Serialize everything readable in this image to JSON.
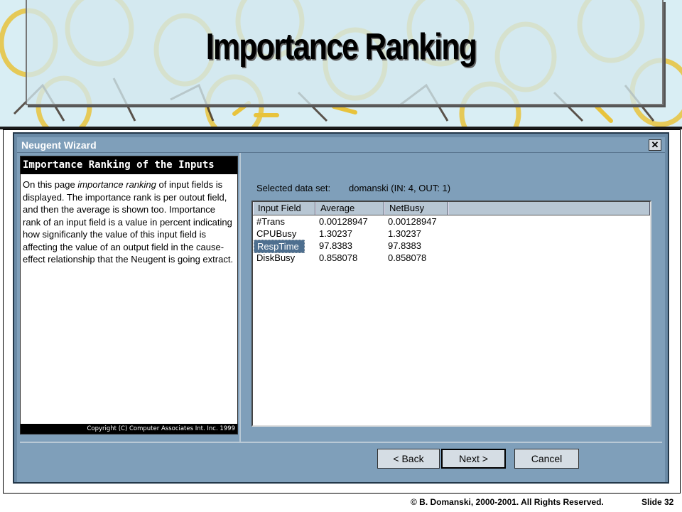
{
  "slide": {
    "title": "Importance Ranking",
    "footer_copyright": "© B. Domanski, 2000-2001.  All Rights Reserved.",
    "footer_slide": "Slide 32"
  },
  "window": {
    "title": "Neugent Wizard",
    "close_glyph": "✕"
  },
  "description": {
    "heading": "Importance Ranking of the Inputs",
    "text_before": "On this page ",
    "text_italic": "importance ranking",
    "text_after": " of input fields is displayed. The importance rank is per outout field, and then the average is shown too. Importance rank of an input field is a value in percent indicating how significanly the value of this input field is affecting the value of an output field in the cause-effect relationship that the Neugent is going extract.",
    "copyright": "Copyright (C) Computer Associates Int. Inc. 1999"
  },
  "dataset": {
    "label": "Selected data set:",
    "value": "domanski (IN: 4, OUT: 1)"
  },
  "table": {
    "columns": [
      "Input Field",
      "Average",
      "NetBusy"
    ],
    "rows": [
      {
        "field": "#Trans",
        "average": "0.00128947",
        "netbusy": "0.00128947"
      },
      {
        "field": "CPUBusy",
        "average": "1.30237",
        "netbusy": "1.30237"
      },
      {
        "field": "RespTime",
        "average": "97.8383",
        "netbusy": "97.8383"
      },
      {
        "field": "DiskBusy",
        "average": "0.858078",
        "netbusy": "0.858078"
      }
    ]
  },
  "buttons": {
    "back": "< Back",
    "next": "Next >",
    "cancel": "Cancel"
  }
}
